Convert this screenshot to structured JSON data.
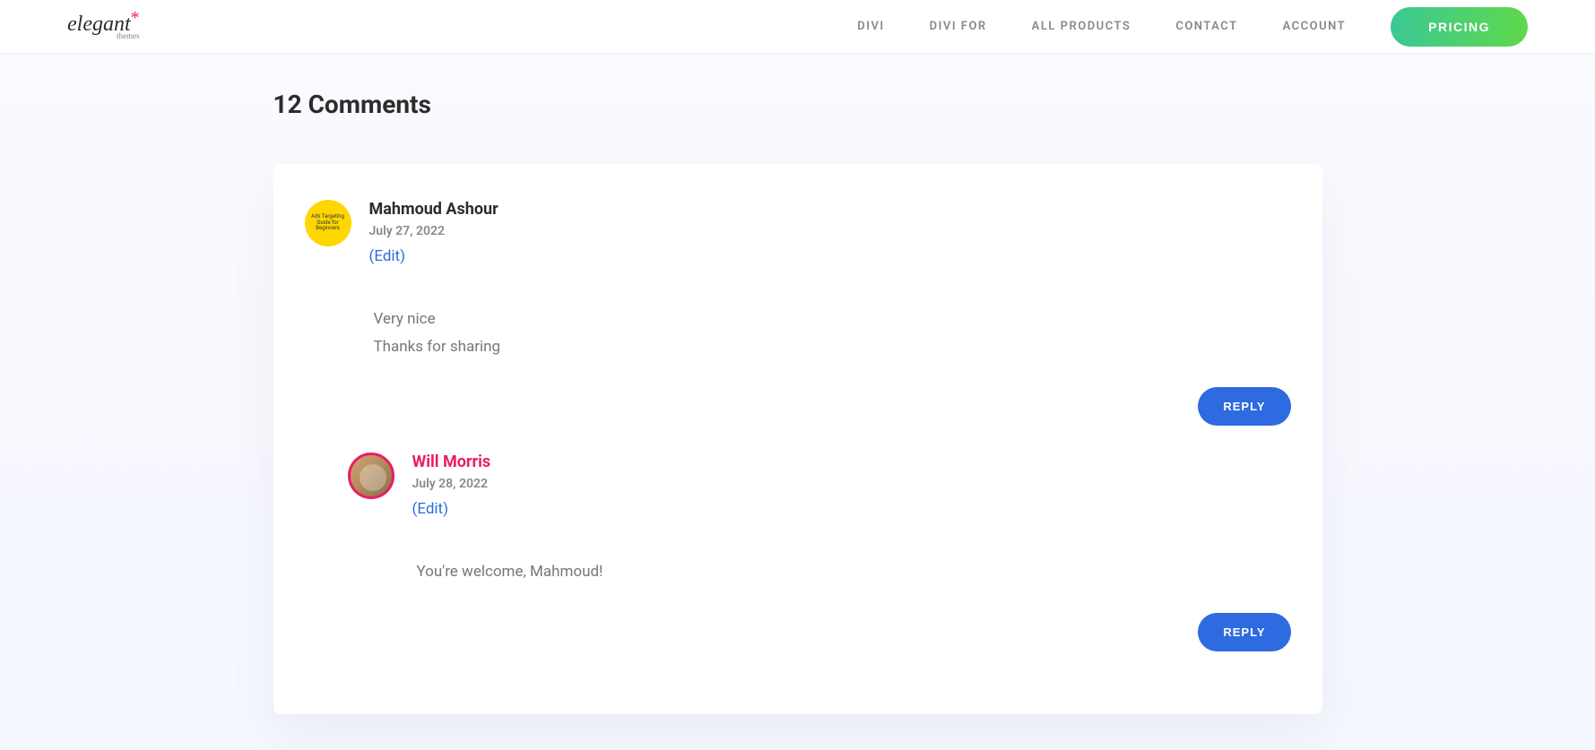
{
  "header": {
    "logo": {
      "main": "elegant",
      "sub": "themes"
    },
    "nav": [
      "DIVI",
      "DIVI FOR",
      "ALL PRODUCTS",
      "CONTACT",
      "ACCOUNT"
    ],
    "pricing_label": "PRICING"
  },
  "comments": {
    "title": "12 Comments",
    "reply_label": "REPLY",
    "items": [
      {
        "author": "Mahmoud Ashour",
        "date": "July 27, 2022",
        "edit": "(Edit)",
        "text_line1": "Very nice",
        "text_line2": "Thanks for sharing",
        "avatar_text": "Ads Targeting Guide for Beginners",
        "staff": false
      },
      {
        "author": "Will Morris",
        "date": "July 28, 2022",
        "edit": "(Edit)",
        "text_line1": "You're welcome, Mahmoud!",
        "staff": true
      }
    ]
  }
}
